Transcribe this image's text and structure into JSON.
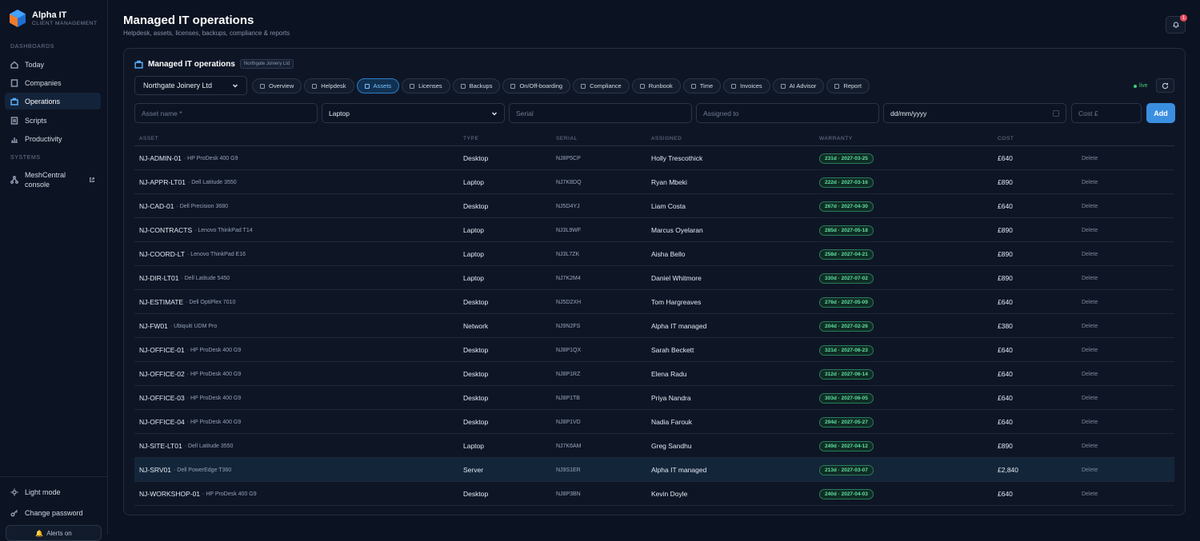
{
  "brand": {
    "name": "Alpha IT",
    "sub": "CLIENT MANAGEMENT"
  },
  "sidebar": {
    "sec_dash": "DASHBOARDS",
    "items": [
      {
        "label": "Today"
      },
      {
        "label": "Companies"
      },
      {
        "label": "Operations"
      },
      {
        "label": "Scripts"
      },
      {
        "label": "Productivity"
      }
    ],
    "sec_systems": "SYSTEMS",
    "meshcentral": {
      "line1": "MeshCentral",
      "line2": "console"
    },
    "light_mode": "Light mode",
    "change_password": "Change password",
    "alerts": "Alerts on"
  },
  "header": {
    "title": "Managed IT operations",
    "subtitle": "Helpdesk, assets, licenses, backups, compliance & reports",
    "notif_count": "1"
  },
  "card": {
    "title": "Managed IT operations",
    "chip": "Northgate Joinery Ltd",
    "company_select": "Northgate Joinery Ltd",
    "live": "live"
  },
  "tabs": [
    {
      "label": "Overview"
    },
    {
      "label": "Helpdesk"
    },
    {
      "label": "Assets"
    },
    {
      "label": "Licenses"
    },
    {
      "label": "Backups"
    },
    {
      "label": "On/Off-boarding"
    },
    {
      "label": "Compliance"
    },
    {
      "label": "Runbook"
    },
    {
      "label": "Time"
    },
    {
      "label": "Invoices"
    },
    {
      "label": "AI Advisor"
    },
    {
      "label": "Report"
    }
  ],
  "form": {
    "asset_name_ph": "Asset name *",
    "type_value": "Laptop",
    "serial_ph": "Serial",
    "assigned_ph": "Assigned to",
    "date_ph": "dd/mm/yyyy",
    "cost_ph": "Cost £",
    "add": "Add"
  },
  "table": {
    "headers": [
      "ASSET",
      "TYPE",
      "SERIAL",
      "ASSIGNED",
      "WARRANTY",
      "COST"
    ],
    "delete_label": "Delete",
    "rows": [
      {
        "asset": "NJ-ADMIN-01",
        "model": "· HP ProDesk 400 G9",
        "type": "Desktop",
        "serial": "NJ8P5CP",
        "assigned": "Holly Trescothick",
        "warranty": "231d · 2027-03-25",
        "cost": "£640"
      },
      {
        "asset": "NJ-APPR-LT01",
        "model": "· Dell Latitude 3550",
        "type": "Laptop",
        "serial": "NJ7K8DQ",
        "assigned": "Ryan Mbeki",
        "warranty": "222d · 2027-03-16",
        "cost": "£890"
      },
      {
        "asset": "NJ-CAD-01",
        "model": "· Dell Precision 3680",
        "type": "Desktop",
        "serial": "NJ5D4YJ",
        "assigned": "Liam Costa",
        "warranty": "267d · 2027-04-30",
        "cost": "£640"
      },
      {
        "asset": "NJ-CONTRACTS",
        "model": "· Lenovo ThinkPad T14",
        "type": "Laptop",
        "serial": "NJ3L9WF",
        "assigned": "Marcus Oyelaran",
        "warranty": "285d · 2027-05-18",
        "cost": "£890"
      },
      {
        "asset": "NJ-COORD-LT",
        "model": "· Lenovo ThinkPad E16",
        "type": "Laptop",
        "serial": "NJ3L7ZK",
        "assigned": "Aisha Bello",
        "warranty": "258d · 2027-04-21",
        "cost": "£890"
      },
      {
        "asset": "NJ-DIR-LT01",
        "model": "· Dell Latitude 5450",
        "type": "Laptop",
        "serial": "NJ7K2M4",
        "assigned": "Daniel Whitmore",
        "warranty": "330d · 2027-07-02",
        "cost": "£890"
      },
      {
        "asset": "NJ-ESTIMATE",
        "model": "· Dell OptiPlex 7010",
        "type": "Desktop",
        "serial": "NJ5D2XH",
        "assigned": "Tom Hargreaves",
        "warranty": "276d · 2027-05-09",
        "cost": "£640"
      },
      {
        "asset": "NJ-FW01",
        "model": "· Ubiquiti UDM Pro",
        "type": "Network",
        "serial": "NJ9N2FS",
        "assigned": "Alpha IT managed",
        "warranty": "204d · 2027-02-26",
        "cost": "£380"
      },
      {
        "asset": "NJ-OFFICE-01",
        "model": "· HP ProDesk 400 G9",
        "type": "Desktop",
        "serial": "NJ8P1QX",
        "assigned": "Sarah Beckett",
        "warranty": "321d · 2027-06-23",
        "cost": "£640"
      },
      {
        "asset": "NJ-OFFICE-02",
        "model": "· HP ProDesk 400 G9",
        "type": "Desktop",
        "serial": "NJ8P1RZ",
        "assigned": "Elena Radu",
        "warranty": "312d · 2027-06-14",
        "cost": "£640"
      },
      {
        "asset": "NJ-OFFICE-03",
        "model": "· HP ProDesk 400 G9",
        "type": "Desktop",
        "serial": "NJ8P1TB",
        "assigned": "Priya Nandra",
        "warranty": "303d · 2027-06-05",
        "cost": "£640"
      },
      {
        "asset": "NJ-OFFICE-04",
        "model": "· HP ProDesk 400 G9",
        "type": "Desktop",
        "serial": "NJ8P1VD",
        "assigned": "Nadia Farouk",
        "warranty": "294d · 2027-05-27",
        "cost": "£640"
      },
      {
        "asset": "NJ-SITE-LT01",
        "model": "· Dell Latitude 3550",
        "type": "Laptop",
        "serial": "NJ7K6AM",
        "assigned": "Greg Sandhu",
        "warranty": "249d · 2027-04-12",
        "cost": "£890"
      },
      {
        "asset": "NJ-SRV01",
        "model": "· Dell PowerEdge T360",
        "type": "Server",
        "serial": "NJ9S1ER",
        "assigned": "Alpha IT managed",
        "warranty": "213d · 2027-03-07",
        "cost": "£2,840"
      },
      {
        "asset": "NJ-WORKSHOP-01",
        "model": "· HP ProDesk 400 G9",
        "type": "Desktop",
        "serial": "NJ8P3BN",
        "assigned": "Kevin Doyle",
        "warranty": "240d · 2027-04-03",
        "cost": "£640"
      }
    ]
  }
}
